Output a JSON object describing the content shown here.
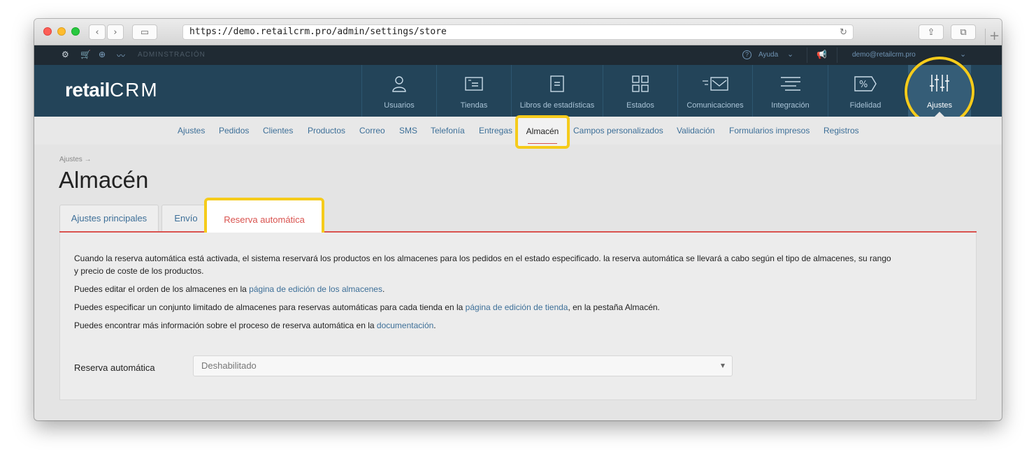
{
  "browser": {
    "url": "https://demo.retailcrm.pro/admin/settings/store",
    "back_glyph": "‹",
    "forward_glyph": "›",
    "sidebar_glyph": "▭",
    "reload_glyph": "↻",
    "share_glyph": "⇪",
    "tabs_glyph": "⧉",
    "new_tab_glyph": "+"
  },
  "topbar": {
    "section": "ADMINSTRACIÓN",
    "help": "Ayuda",
    "help_glyph": "?",
    "chevron_glyph": "⌄",
    "email": "demo@retailcrm.pro"
  },
  "logo": {
    "retail": "retail",
    "crm": "CRM"
  },
  "main_nav": [
    {
      "label": "Usuarios",
      "icon": "user-icon"
    },
    {
      "label": "Tiendas",
      "icon": "store-icon"
    },
    {
      "label": "Libros de estadísticas",
      "icon": "document-icon"
    },
    {
      "label": "Estados",
      "icon": "grid-icon"
    },
    {
      "label": "Comunicaciones",
      "icon": "mail-icon"
    },
    {
      "label": "Integración",
      "icon": "lines-icon"
    },
    {
      "label": "Fidelidad",
      "icon": "percent-tag-icon"
    },
    {
      "label": "Ajustes",
      "icon": "sliders-icon",
      "active": true
    }
  ],
  "sub_nav": [
    "Ajustes",
    "Pedidos",
    "Clientes",
    "Productos",
    "Correo",
    "SMS",
    "Telefonía",
    "Entregas",
    "Almacén",
    "Campos personalizados",
    "Validación",
    "Formularios impresos",
    "Registros"
  ],
  "breadcrumb": "Ajustes →",
  "page_title": "Almacén",
  "tabs": [
    "Ajustes principales",
    "Envío",
    "Reserva automática"
  ],
  "content": {
    "p1_line1": "Cuando la reserva automática está activada, el sistema reservará los productos en los almacenes para los pedidos en el estado especificado. la reserva automática se llevará a cabo según el tipo de almacenes, su rango",
    "p1_line2": "y precio de coste de los productos.",
    "p2_before": "Puedes editar el orden de los almacenes en la ",
    "p2_link": "página de edición de los almacenes",
    "p2_after": ".",
    "p3_before": "Puedes especificar un conjunto limitado de almacenes para reservas automáticas para cada tienda en la ",
    "p3_link": "página de edición de tienda",
    "p3_after": ", en la pestaña Almacén.",
    "p4_before": "Puedes encontrar más información sobre el proceso de reserva automática en la ",
    "p4_link": "documentación",
    "p4_after": "."
  },
  "form": {
    "label": "Reserva automática",
    "select_value": "Deshabilitado",
    "caret_glyph": "▼"
  },
  "colors": {
    "header": "#234459",
    "topbar": "#1f2a33",
    "accent": "#d9534f",
    "highlight": "#f5cb1b",
    "link": "#3d6f98"
  }
}
